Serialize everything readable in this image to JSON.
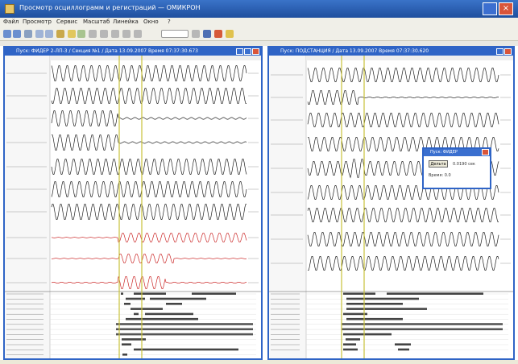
{
  "app": {
    "title": "Просмотр осциллограмм и регистраций — ОМИКРОН",
    "close_label": "×"
  },
  "menu": [
    {
      "label": "Файл"
    },
    {
      "label": "Просмотр"
    },
    {
      "label": "Сервис"
    },
    {
      "label": "Масштаб"
    },
    {
      "label": "Линейка"
    },
    {
      "label": "Окно"
    },
    {
      "label": "?"
    }
  ],
  "panels": [
    {
      "title": "Пуск: ФИДЕР 2-ЛП-3 / Секция №1 / Дата 13.09.2007 Время 07:37:30.673"
    },
    {
      "title": "Пуск: ПОДСТАНЦИЯ / Дата 13.09.2007 Время 07:37:30.620"
    }
  ],
  "dialog": {
    "title": "Пуск: ФИДЕР",
    "button_label": "Дельта",
    "value": "0.0190 сек",
    "line2": "Время: 0.0"
  },
  "colors": {
    "window_blue": "#2f64c6",
    "trace_black": "#222222",
    "trace_red": "#cc2b2b",
    "cursor_yellow": "#c9c23a",
    "digital_bar": "#444444"
  }
}
